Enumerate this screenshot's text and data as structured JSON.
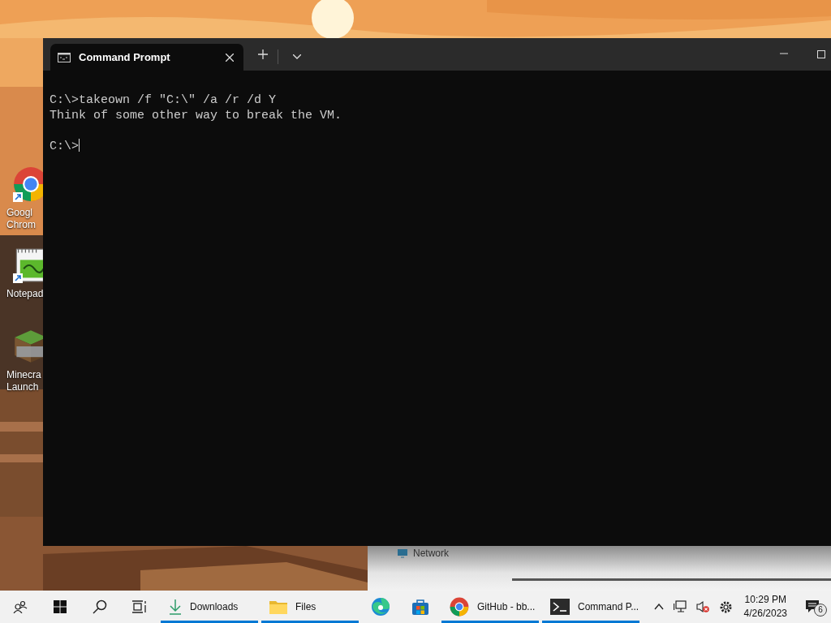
{
  "desktop_icons": [
    {
      "kind": "chrome",
      "label_lines": [
        "Googl",
        "Chrom"
      ],
      "shortcut": true
    },
    {
      "kind": "notepad",
      "label_lines": [
        "Notepad"
      ],
      "shortcut": true
    },
    {
      "kind": "minecraft",
      "label_lines": [
        "Minecra",
        "Launch"
      ],
      "shortcut": false
    }
  ],
  "background_window": {
    "label": "Network"
  },
  "terminal": {
    "tab_title": "Command Prompt",
    "blocks": [
      {
        "lines": [
          "C:\\>takeown /f \"C:\\\" /a /r /d Y",
          "Think of some other way to break the VM."
        ],
        "cursor": false
      },
      {
        "lines": [
          "C:\\>"
        ],
        "cursor": true
      }
    ]
  },
  "taskbar": {
    "buttons": [
      {
        "kind": "people",
        "running": false
      },
      {
        "kind": "start",
        "running": false
      },
      {
        "kind": "search",
        "running": false
      },
      {
        "kind": "task-view",
        "running": false
      },
      {
        "kind": "downloads",
        "label": "Downloads",
        "running": true
      },
      {
        "kind": "folder",
        "label": "Files",
        "running": true
      },
      {
        "kind": "edge",
        "running": false
      },
      {
        "kind": "store",
        "running": false
      },
      {
        "kind": "chrome",
        "label": "GitHub - bb...",
        "running": true
      },
      {
        "kind": "terminal",
        "label": "Command P...",
        "running": true
      }
    ],
    "tray": {
      "icons": [
        {
          "kind": "chevron"
        },
        {
          "kind": "network"
        },
        {
          "kind": "volume-muted"
        },
        {
          "kind": "gear"
        }
      ],
      "time": "10:29 PM",
      "date": "4/26/2023",
      "notifications": "6"
    }
  }
}
